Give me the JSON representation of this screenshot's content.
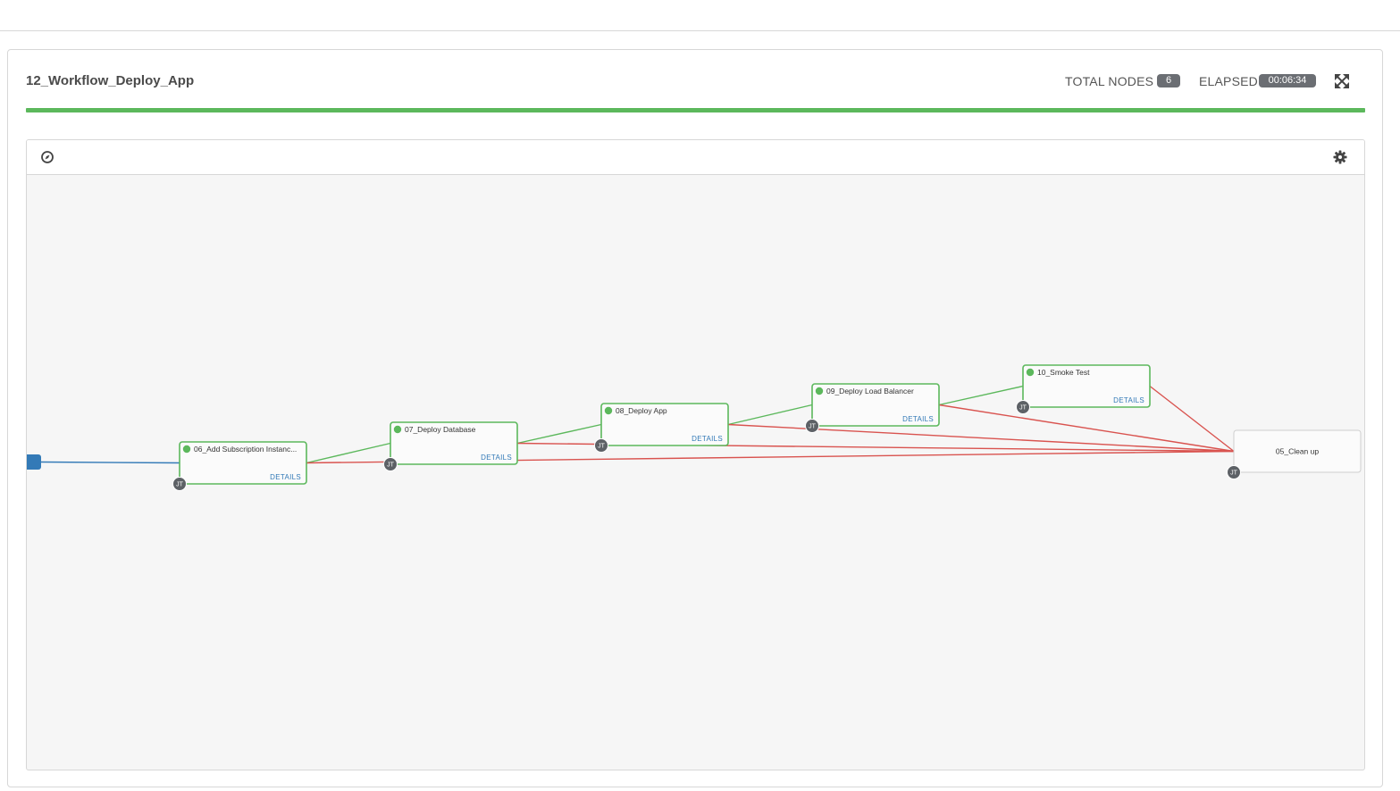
{
  "workflow": {
    "title": "12_Workflow_Deploy_App",
    "total_nodes_label": "TOTAL NODES",
    "total_nodes_value": "6",
    "elapsed_label": "ELAPSED",
    "elapsed_value": "00:06:34",
    "progress_percent": 100
  },
  "colors": {
    "success": "#5cb85c",
    "failure": "#d9534f",
    "start": "#337ab7",
    "badge": "#6b6e73"
  },
  "toolbar": {
    "left_icon": "compass-icon",
    "right_icon": "gear-icon"
  },
  "nodes": [
    {
      "label": "06_Add Subscription Instanc...",
      "status": "success",
      "details": "DETAILS",
      "badge": "JT"
    },
    {
      "label": "07_Deploy Database",
      "status": "success",
      "details": "DETAILS",
      "badge": "JT"
    },
    {
      "label": "08_Deploy App",
      "status": "success",
      "details": "DETAILS",
      "badge": "JT"
    },
    {
      "label": "09_Deploy Load Balancer",
      "status": "success",
      "details": "DETAILS",
      "badge": "JT"
    },
    {
      "label": "10_Smoke Test",
      "status": "success",
      "details": "DETAILS",
      "badge": "JT"
    },
    {
      "label": "05_Clean up",
      "status": "not-run",
      "details": "",
      "badge": "JT"
    }
  ],
  "links": [
    {
      "from": "start",
      "to": 0,
      "type": "always"
    },
    {
      "from": 0,
      "to": 1,
      "type": "success"
    },
    {
      "from": 1,
      "to": 2,
      "type": "success"
    },
    {
      "from": 2,
      "to": 3,
      "type": "success"
    },
    {
      "from": 3,
      "to": 4,
      "type": "success"
    },
    {
      "from": 0,
      "to": 5,
      "type": "failure"
    },
    {
      "from": 1,
      "to": 5,
      "type": "failure"
    },
    {
      "from": 2,
      "to": 5,
      "type": "failure"
    },
    {
      "from": 3,
      "to": 5,
      "type": "failure"
    },
    {
      "from": 4,
      "to": 5,
      "type": "failure"
    }
  ]
}
